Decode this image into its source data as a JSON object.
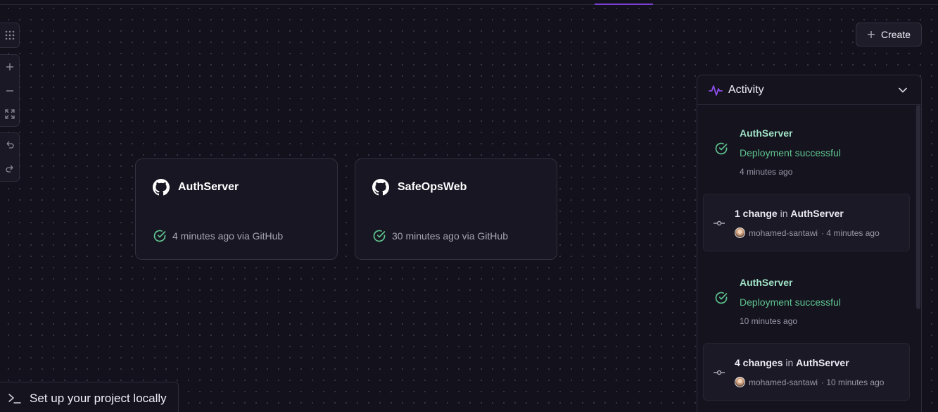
{
  "toolbar": {
    "icons": [
      "grid-icon",
      "zoom-in-icon",
      "zoom-out-icon",
      "fit-view-icon",
      "undo-icon",
      "redo-icon"
    ]
  },
  "create_button": {
    "label": "Create"
  },
  "services": [
    {
      "name": "AuthServer",
      "meta": "4 minutes ago via GitHub"
    },
    {
      "name": "SafeOpsWeb",
      "meta": "30 minutes ago via GitHub"
    }
  ],
  "activity": {
    "title": "Activity",
    "items": [
      {
        "type": "deploy",
        "service": "AuthServer",
        "status": "Deployment successful",
        "time": "4 minutes ago"
      },
      {
        "type": "change",
        "count": "1 change",
        "in": "in",
        "service": "AuthServer",
        "author": "mohamed-santawi",
        "time": "· 4 minutes ago"
      },
      {
        "type": "deploy",
        "service": "AuthServer",
        "status": "Deployment successful",
        "time": "10 minutes ago"
      },
      {
        "type": "change",
        "count": "4 changes",
        "in": "in",
        "service": "AuthServer",
        "author": "mohamed-santawi",
        "time": "· 10 minutes ago"
      }
    ]
  },
  "setup_banner": {
    "label": "Set up your project locally"
  },
  "colors": {
    "background": "#13111c",
    "accent": "#7b3fd6",
    "success": "#5ec48e",
    "success_light": "#9fe2c5"
  }
}
